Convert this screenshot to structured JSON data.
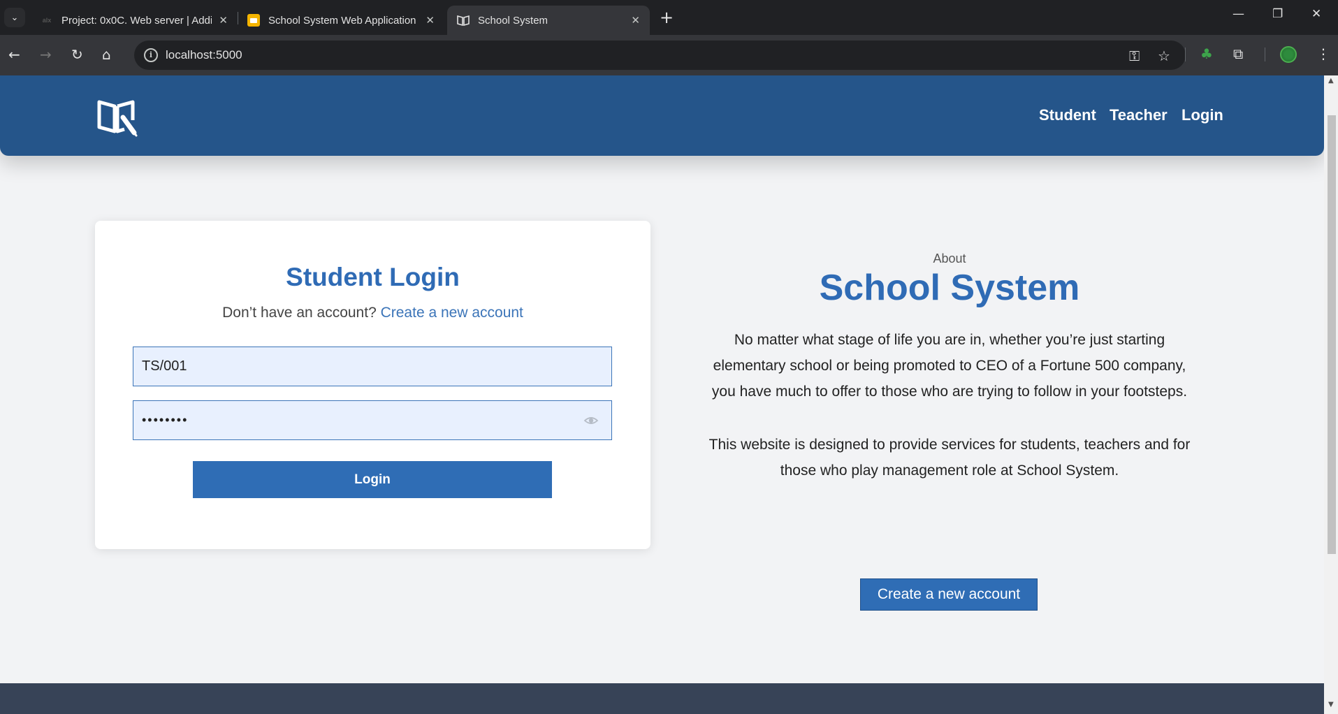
{
  "browser": {
    "tabs": [
      {
        "title": "Project: 0x0C. Web server | Addi",
        "favicon": "alx-icon"
      },
      {
        "title": "School System Web Application",
        "favicon": "slides-icon"
      },
      {
        "title": "School System",
        "favicon": "book-icon",
        "active": true
      }
    ],
    "url": "localhost:5000"
  },
  "site": {
    "nav": {
      "student": "Student",
      "teacher": "Teacher",
      "login": "Login"
    },
    "login_card": {
      "title": "Student Login",
      "subtitle_prefix": "Don’t have an account?",
      "subtitle_link": "Create a new account",
      "username_value": "TS/001",
      "password_value": "••••••••",
      "login_button": "Login"
    },
    "about": {
      "kicker": "About",
      "title": "School System",
      "paragraph1_line1": "No matter what stage of life you are in, whether you’re just starting",
      "paragraph1_line2": "elementary school or being promoted to CEO of a Fortune 500 company,",
      "paragraph1_line3": "you have much to offer to those who are trying to follow in your footsteps.",
      "paragraph2_line1": "This website is designed to provide services for students, teachers and for",
      "paragraph2_line2": "those who play management role at School System.",
      "button": "Create a new account"
    }
  },
  "colors": {
    "header": "#25558a",
    "accent": "#2f6bb5",
    "page_bg": "#f2f3f5",
    "footer": "#374357"
  }
}
